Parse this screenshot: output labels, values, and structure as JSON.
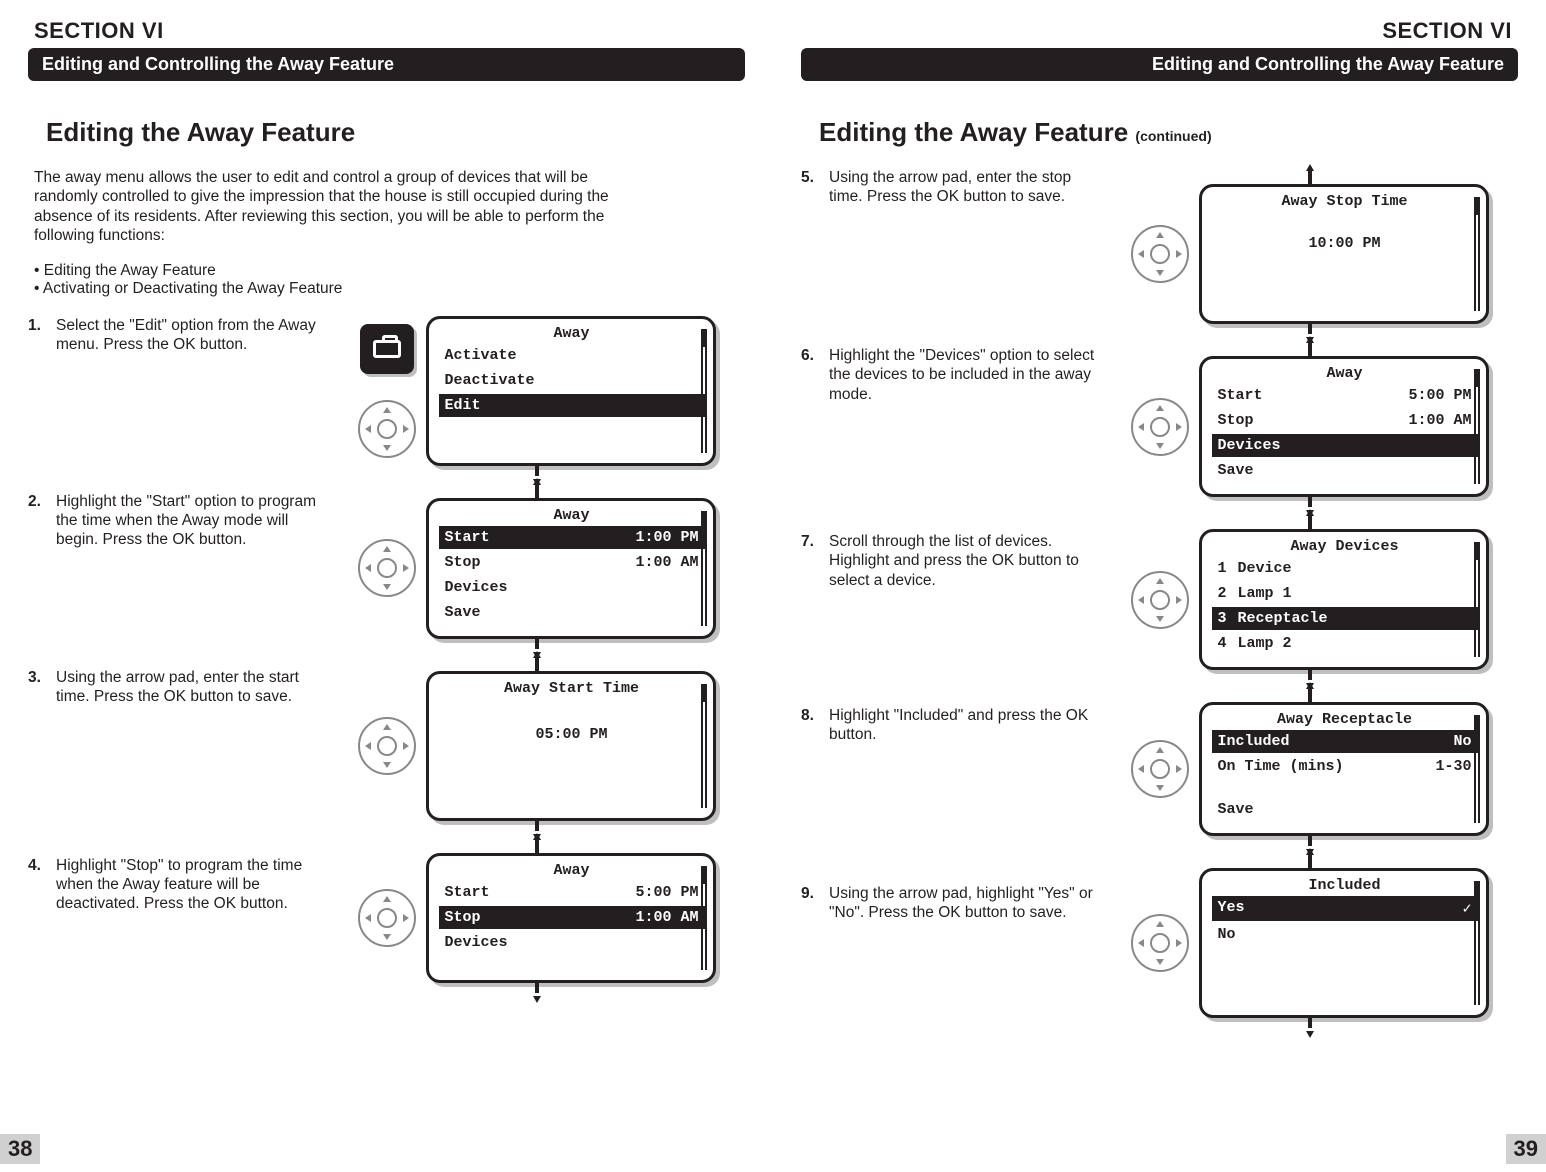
{
  "section_label": "SECTION VI",
  "header_text": "Editing and Controlling the Away Feature",
  "left": {
    "h2": "Editing the Away Feature",
    "intro": "The away menu allows the user to edit and control a group of devices that will be randomly controlled to give the impression that the house is still occupied during the absence of its residents. After reviewing this section, you will be able to perform the following functions:",
    "bullet1": "• Editing the Away Feature",
    "bullet2": "• Activating or Deactivating the Away Feature",
    "step1_num": "1.",
    "step1_text": "Select the \"Edit\" option from the Away menu. Press the OK button.",
    "step2_num": "2.",
    "step2_text": "Highlight the \"Start\" option to program the time when the Away mode will begin. Press the OK button.",
    "step3_num": "3.",
    "step3_text": "Using the arrow pad, enter the start time. Press the OK button to save.",
    "step4_num": "4.",
    "step4_text": "Highlight \"Stop\" to program the time when the Away feature will be deactivated. Press the OK button.",
    "screen1": {
      "title": "Away",
      "opt1": "Activate",
      "opt2": "Deactivate",
      "opt3": "Edit"
    },
    "screen2": {
      "title": "Away",
      "l1a": "Start",
      "l1b": "1:00 PM",
      "l2a": "Stop",
      "l2b": "1:00 AM",
      "l3": "Devices",
      "l4": "Save"
    },
    "screen3": {
      "title": "Away Start Time",
      "val": "05:00 PM"
    },
    "screen4": {
      "title": "Away",
      "l1a": "Start",
      "l1b": "5:00 PM",
      "l2a": "Stop",
      "l2b": "1:00 AM",
      "l3": "Devices"
    },
    "pagenum": "38"
  },
  "right": {
    "h2a": "Editing the Away Feature ",
    "h2b": "(continued)",
    "step5_num": "5.",
    "step5_text": "Using the arrow pad, enter the stop time. Press the OK button to save.",
    "step6_num": "6.",
    "step6_text": "Highlight the \"Devices\" option to select the devices to be included in the away mode.",
    "step7_num": "7.",
    "step7_text": "Scroll through the list of devices. Highlight and press the OK button to select a device.",
    "step8_num": "8.",
    "step8_text": "Highlight \"Included\" and press the OK button.",
    "step9_num": "9.",
    "step9_text": "Using the arrow pad, highlight \"Yes\" or \"No\". Press the OK button to save.",
    "screen5": {
      "title": "Away Stop Time",
      "val": "10:00 PM"
    },
    "screen6": {
      "title": "Away",
      "l1a": "Start",
      "l1b": "5:00 PM",
      "l2a": "Stop",
      "l2b": "1:00 AM",
      "l3": "Devices",
      "l4": "Save"
    },
    "screen7": {
      "title": "Away Devices",
      "n1": "1",
      "d1": "Device",
      "n2": "2",
      "d2": "Lamp 1",
      "n3": "3",
      "d3": "Receptacle",
      "n4": "4",
      "d4": "Lamp 2"
    },
    "screen8": {
      "title": "Away Receptacle",
      "l1a": "Included",
      "l1b": "No",
      "l2a": "On Time (mins)",
      "l2b": "1-30",
      "l3": "Save"
    },
    "screen9": {
      "title": "Included",
      "o1": "Yes",
      "o2": "No"
    },
    "pagenum": "39"
  }
}
